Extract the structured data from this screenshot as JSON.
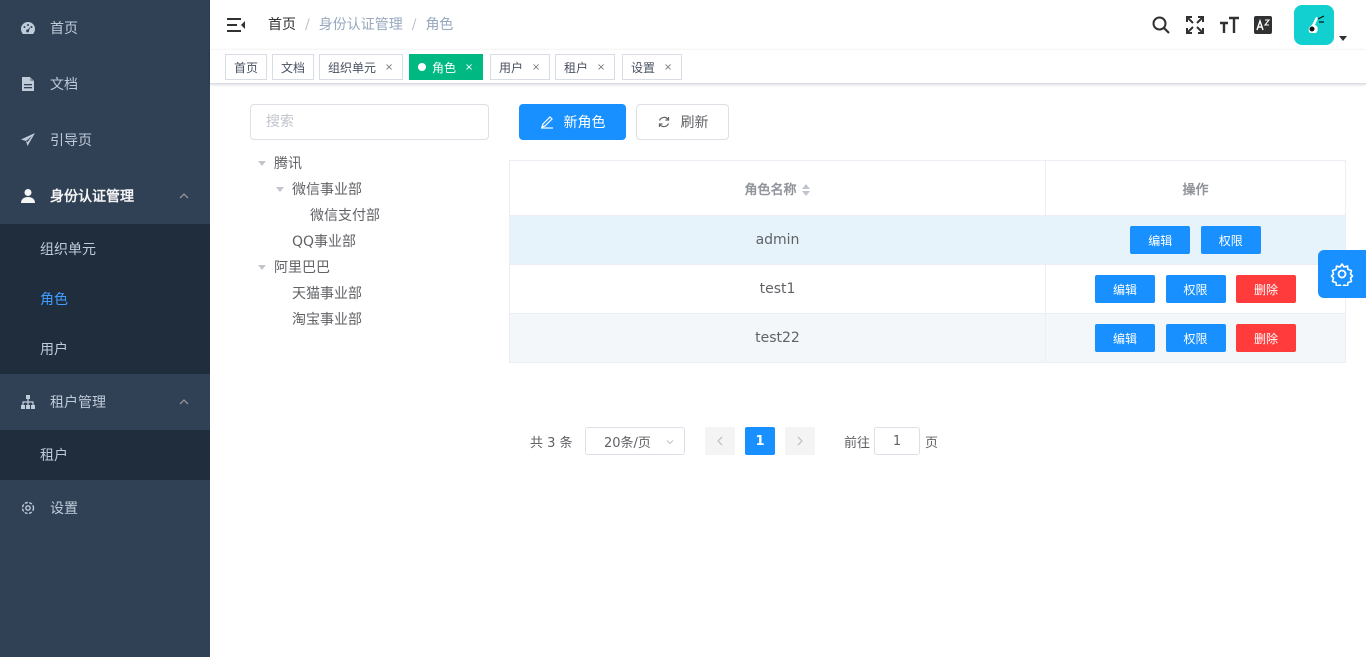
{
  "sidebar": {
    "items": [
      {
        "label": "首页",
        "icon": "dashboard-icon"
      },
      {
        "label": "文档",
        "icon": "document-icon"
      },
      {
        "label": "引导页",
        "icon": "guide-icon"
      },
      {
        "label": "身份认证管理",
        "icon": "user-icon"
      },
      {
        "label": "租户管理",
        "icon": "tree-icon"
      },
      {
        "label": "设置",
        "icon": "gear-icon"
      }
    ],
    "identity_sub": [
      "组织单元",
      "角色",
      "用户"
    ],
    "tenant_sub": [
      "租户"
    ]
  },
  "navbar": {
    "breadcrumb": [
      "首页",
      "身份认证管理",
      "角色"
    ]
  },
  "tags": [
    {
      "label": "首页"
    },
    {
      "label": "文档"
    },
    {
      "label": "组织单元",
      "close": "×"
    },
    {
      "label": "角色",
      "close": "×"
    },
    {
      "label": "用户",
      "close": "×"
    },
    {
      "label": "租户",
      "close": "×"
    },
    {
      "label": "设置",
      "close": "×"
    }
  ],
  "search": {
    "placeholder": "搜索"
  },
  "tree": [
    {
      "label": "腾讯"
    },
    {
      "label": "微信事业部"
    },
    {
      "label": "微信支付部"
    },
    {
      "label": "QQ事业部"
    },
    {
      "label": "阿里巴巴"
    },
    {
      "label": "天猫事业部"
    },
    {
      "label": "淘宝事业部"
    }
  ],
  "toolbar": {
    "new_label": "新角色",
    "refresh_label": "刷新"
  },
  "table": {
    "headers": [
      "角色名称",
      "操作"
    ],
    "rows": [
      {
        "name": "admin"
      },
      {
        "name": "test1"
      },
      {
        "name": "test22"
      }
    ],
    "edit_label": "编辑",
    "perm_label": "权限",
    "delete_label": "删除"
  },
  "pager": {
    "total": "共 3 条",
    "size": "20条/页",
    "current": "1",
    "goto": "前往",
    "goto_value": "1",
    "page_suffix": "页"
  },
  "colors": {
    "primary": "#1890ff",
    "danger": "#ff3b3b",
    "active_tag": "#00b982",
    "sidebar": "#304156"
  }
}
